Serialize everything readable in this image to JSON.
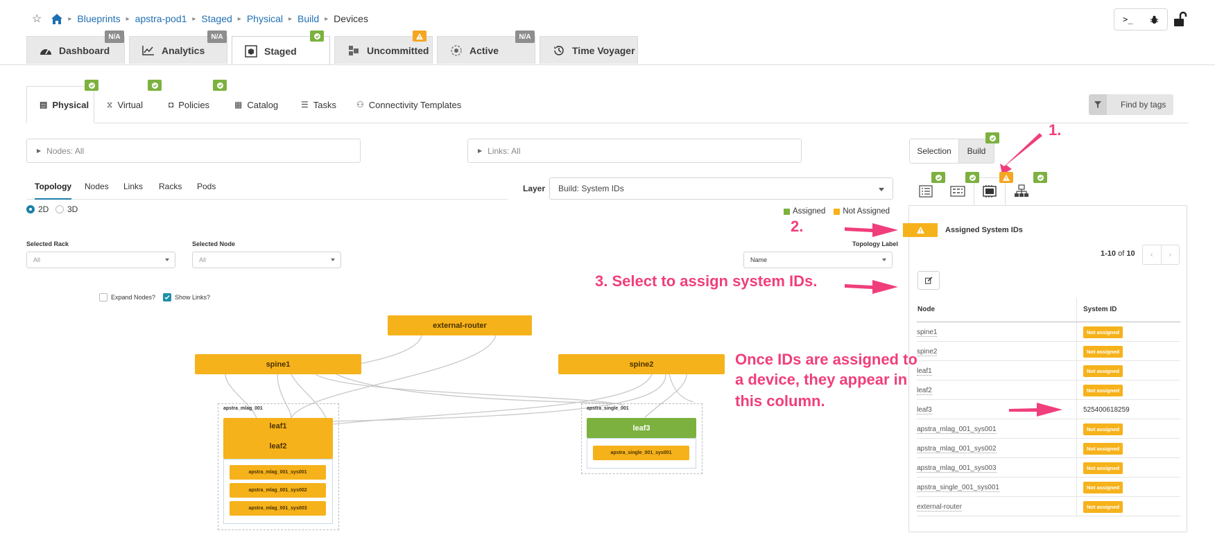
{
  "breadcrumb": {
    "items": [
      "Blueprints",
      "apstra-pod1",
      "Staged",
      "Physical",
      "Build"
    ],
    "current": "Devices"
  },
  "top_tabs": [
    {
      "label": "Dashboard",
      "badge": "N/A"
    },
    {
      "label": "Analytics",
      "badge": "N/A"
    },
    {
      "label": "Staged",
      "badge": "ok"
    },
    {
      "label": "Uncommitted",
      "badge": "warn"
    },
    {
      "label": "Active",
      "badge": "N/A"
    },
    {
      "label": "Time Voyager",
      "badge": ""
    }
  ],
  "toolbar": {
    "terminal": ">_",
    "bug": "bug-icon"
  },
  "sub_tabs": [
    {
      "label": "Physical",
      "icon": "server-icon"
    },
    {
      "label": "Virtual",
      "icon": "network-icon"
    },
    {
      "label": "Policies",
      "icon": "shield-icon"
    },
    {
      "label": "Catalog",
      "icon": "book-icon"
    },
    {
      "label": "Tasks",
      "icon": "list-icon"
    },
    {
      "label": "Connectivity Templates",
      "icon": "sitemap-icon"
    }
  ],
  "find_by_tags": "Find by tags",
  "nodes_filter": "Nodes: All",
  "links_filter": "Links: All",
  "mode": {
    "selection": "Selection",
    "build": "Build"
  },
  "view_tabs": [
    "Topology",
    "Nodes",
    "Links",
    "Racks",
    "Pods"
  ],
  "dims": {
    "d2": "2D",
    "d3": "3D"
  },
  "layer": {
    "label": "Layer",
    "value": "Build: System IDs"
  },
  "legend": {
    "assigned": "Assigned",
    "not_assigned": "Not Assigned",
    "assigned_color": "#7cb13f",
    "not_assigned_color": "#f6b21b"
  },
  "filters": {
    "rack_label": "Selected Rack",
    "rack_value": "All",
    "node_label": "Selected Node",
    "node_value": "All",
    "topo_label": "Topology Label",
    "topo_value": "Name",
    "expand_nodes": "Expand Nodes?",
    "show_links": "Show Links?"
  },
  "topology": {
    "external": "external-router",
    "spine1": "spine1",
    "spine2": "spine2",
    "rack1": "apstra_mlag_001",
    "rack2": "apstra_single_001",
    "leaf1": "leaf1",
    "leaf2": "leaf2",
    "leaf3": "leaf3",
    "sys1": "apstra_mlag_001_sys001",
    "sys2": "apstra_mlag_001_sys002",
    "sys3": "apstra_mlag_001_sys003",
    "sys4": "apstra_single_001_sys001"
  },
  "annotations": {
    "a1": "1.",
    "a2": "2.",
    "a3": "3. Select to assign system IDs.",
    "a4_l1": "Once IDs are assigned to",
    "a4_l2": "a device, they appear in",
    "a4_l3": "this column."
  },
  "panel": {
    "title": "Assigned System IDs",
    "pagination": "1-10",
    "pagination_of": "of",
    "pagination_total": "10",
    "col_node": "Node",
    "col_sysid": "System ID",
    "rows": [
      {
        "node": "spine1",
        "sysid": "Not assigned"
      },
      {
        "node": "spine2",
        "sysid": "Not assigned"
      },
      {
        "node": "leaf1",
        "sysid": "Not assigned"
      },
      {
        "node": "leaf2",
        "sysid": "Not assigned"
      },
      {
        "node": "leaf3",
        "sysid": "525400618259"
      },
      {
        "node": "apstra_mlag_001_sys001",
        "sysid": "Not assigned"
      },
      {
        "node": "apstra_mlag_001_sys002",
        "sysid": "Not assigned"
      },
      {
        "node": "apstra_mlag_001_sys003",
        "sysid": "Not assigned"
      },
      {
        "node": "apstra_single_001_sys001",
        "sysid": "Not assigned"
      },
      {
        "node": "external-router",
        "sysid": "Not assigned"
      }
    ]
  }
}
